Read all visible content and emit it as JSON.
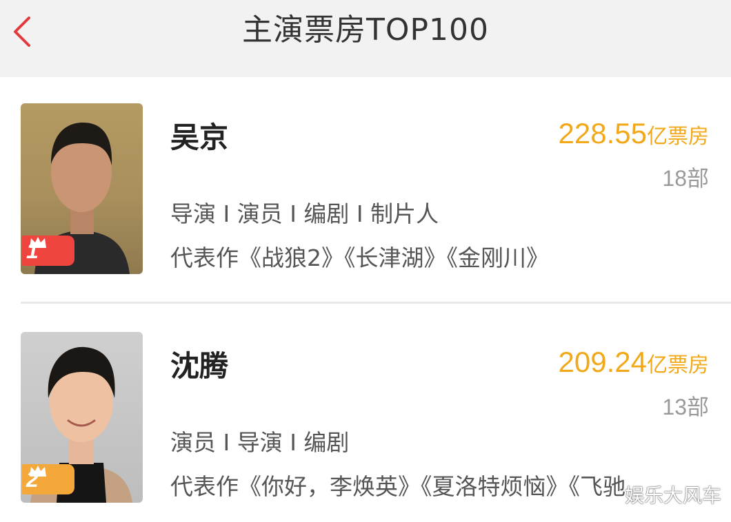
{
  "header": {
    "title": "主演票房TOP100",
    "back_icon": "chevron-left-icon",
    "accent": "#e4393c"
  },
  "actors": [
    {
      "rank": "1",
      "name": "吴京",
      "box_office": "228.55",
      "box_office_unit": "亿票房",
      "film_count": "18部",
      "roles": "导演 I 演员 I 编剧 I 制片人",
      "works": "代表作《战狼2》《长津湖》《金刚川》",
      "rank_color": "#f0453f"
    },
    {
      "rank": "2",
      "name": "沈腾",
      "box_office": "209.24",
      "box_office_unit": "亿票房",
      "film_count": "13部",
      "roles": "演员 I 导演 I 编剧",
      "works": "代表作《你好，李焕英》《夏洛特烦恼》《飞驰",
      "rank_color": "#f4a83a"
    }
  ],
  "colors": {
    "box_office": "#f1a91a",
    "header_bg": "#f2f2f2"
  },
  "watermark": "娱乐大风车"
}
